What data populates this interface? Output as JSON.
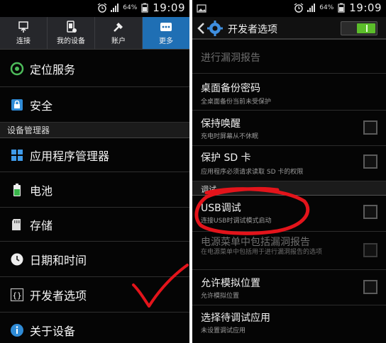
{
  "status_bar": {
    "battery": "64%",
    "time": "19:09",
    "icons": [
      "alarm-icon",
      "signal-icon",
      "battery-icon",
      "image-notification-icon"
    ]
  },
  "left": {
    "tabs": [
      {
        "label": "连接",
        "icon": "connection-icon",
        "active": false
      },
      {
        "label": "我的设备",
        "icon": "my-device-icon",
        "active": false
      },
      {
        "label": "账户",
        "icon": "account-key-icon",
        "active": false
      },
      {
        "label": "更多",
        "icon": "more-dots-icon",
        "active": true
      }
    ],
    "items": [
      {
        "label": "定位服务",
        "icon": "location-icon"
      },
      {
        "label": "安全",
        "icon": "lock-icon"
      }
    ],
    "section_device_manager": "设备管理器",
    "items2": [
      {
        "label": "应用程序管理器",
        "icon": "apps-grid-icon"
      },
      {
        "label": "电池",
        "icon": "battery-icon"
      },
      {
        "label": "存储",
        "icon": "storage-icon"
      },
      {
        "label": "日期和时间",
        "icon": "clock-icon"
      },
      {
        "label": "开发者选项",
        "icon": "developer-braces-icon"
      },
      {
        "label": "关于设备",
        "icon": "info-icon"
      }
    ]
  },
  "right": {
    "header_title": "开发者选项",
    "toggle_on": true,
    "rows": [
      {
        "title": "进行漏洞报告",
        "subtitle": "",
        "checkbox": false,
        "dim": true
      },
      {
        "title": "桌面备份密码",
        "subtitle": "全桌面备份当前未受保护",
        "checkbox": false,
        "dim": false
      },
      {
        "title": "保持唤醒",
        "subtitle": "充电时屏幕从不休眠",
        "checkbox": true,
        "dim": false
      },
      {
        "title": "保护 SD 卡",
        "subtitle": "应用程序必须请求读取 SD 卡的权限",
        "checkbox": true,
        "dim": false
      }
    ],
    "section_debug": "调试",
    "rows2": [
      {
        "title": "USB调试",
        "subtitle": "连接USB时调试模式启动",
        "checkbox": true,
        "dim": false
      },
      {
        "title": "电源菜单中包括漏洞报告",
        "subtitle": "在电源菜单中包括用于进行漏洞报告的选项",
        "checkbox": true,
        "dim": true
      },
      {
        "title": "允许模拟位置",
        "subtitle": "允许模拟位置",
        "checkbox": true,
        "dim": false
      },
      {
        "title": "选择待调试应用",
        "subtitle": "未设置调试应用",
        "checkbox": false,
        "dim": false
      }
    ]
  },
  "colors": {
    "active_tab": "#1f6fb4",
    "toggle_on": "#5bbd2a",
    "annotation_red": "#e3141b"
  }
}
